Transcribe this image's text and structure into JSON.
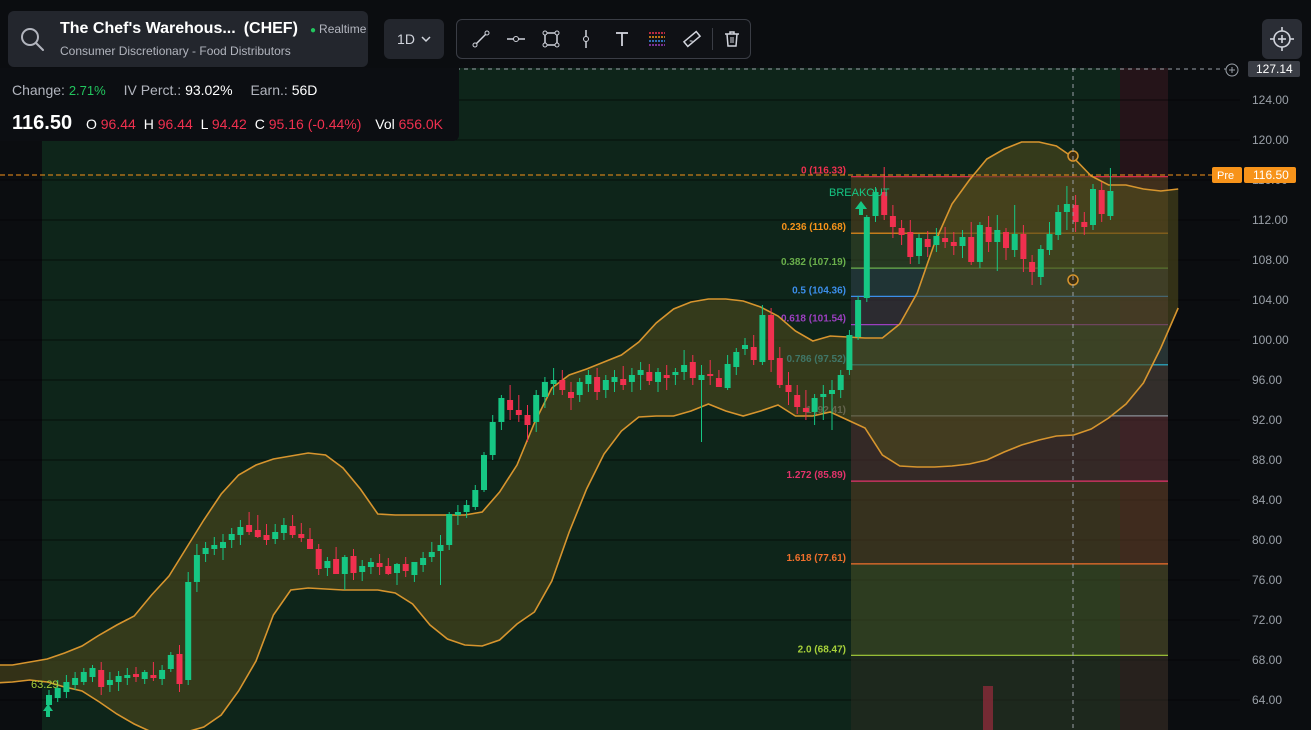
{
  "header": {
    "symbol_name": "The Chef's Warehous...",
    "ticker": "(CHEF)",
    "realtime": "Realtime",
    "sector": "Consumer Discretionary - Food Distributors",
    "timeframe": "1D"
  },
  "info": {
    "change_label": "Change:",
    "change_value": "2.71%",
    "iv_label": "IV Perct.:",
    "iv_value": "93.02%",
    "earn_label": "Earn.:",
    "earn_value": "56D",
    "last_price": "116.50",
    "open_label": "O",
    "open_value": "96.44",
    "high_label": "H",
    "high_value": "96.44",
    "low_label": "L",
    "low_value": "94.42",
    "close_label": "C",
    "close_value": "95.16 (-0.44%)",
    "vol_label": "Vol",
    "vol_value": "656.0K"
  },
  "toolbar": {
    "tools": [
      "trend-line-icon",
      "horizontal-line-icon",
      "rectangle-icon",
      "vertical-line-icon",
      "text-icon",
      "fibonacci-icon",
      "ruler-icon",
      "trash-icon"
    ]
  },
  "colors": {
    "bull": "#16c784",
    "bear": "#f0304f",
    "band": "#d7952e",
    "band_fill": "#4f4a1c",
    "background": "#0b0d10",
    "highlight": "#0f2a1c",
    "accent_orange": "#f7931a"
  },
  "chart_data": {
    "type": "candlestick",
    "y_axis": {
      "ticks": [
        "124.00",
        "120.00",
        "116.00",
        "112.00",
        "108.00",
        "104.00",
        "100.00",
        "96.00",
        "92.00",
        "88.00",
        "84.00",
        "80.00",
        "76.00",
        "72.00",
        "68.00",
        "64.00"
      ],
      "range": [
        61.0,
        127.5
      ],
      "cursor_label": "127.14"
    },
    "price_tag": {
      "label": "Pre",
      "value": "116.50",
      "price": 116.5
    },
    "fibonacci": [
      {
        "label": "0 (116.33)",
        "price": 116.33,
        "color": "#f0304f"
      },
      {
        "label": "0.236 (110.68)",
        "price": 110.68,
        "color": "#f7931a"
      },
      {
        "label": "0.382 (107.19)",
        "price": 107.19,
        "color": "#6ab04c"
      },
      {
        "label": "0.5 (104.36)",
        "price": 104.36,
        "color": "#3b8eea"
      },
      {
        "label": "0.618 (101.54)",
        "price": 101.54,
        "color": "#9b3fc0"
      },
      {
        "label": "0.786 (97.52)",
        "price": 97.52,
        "color": "#2ab8d6"
      },
      {
        "label": "1 (92.41)",
        "price": 92.41,
        "color": "#8a8f98"
      },
      {
        "label": "1.272 (85.89)",
        "price": 85.89,
        "color": "#e2336b"
      },
      {
        "label": "1.618 (77.61)",
        "price": 77.61,
        "color": "#f0702c"
      },
      {
        "label": "2.0 (68.47)",
        "price": 68.47,
        "color": "#a7d13a"
      }
    ],
    "annotations": [
      {
        "label": "63.29",
        "price": 63.29
      },
      {
        "label": "BREAKOUT",
        "price": 114.5
      }
    ],
    "candles": [
      [
        63.5,
        65,
        62.8,
        64.5
      ],
      [
        64.2,
        66,
        63.8,
        65.2
      ],
      [
        64.8,
        66.5,
        64.2,
        65.8
      ],
      [
        65.5,
        66.8,
        65,
        66.2
      ],
      [
        65.8,
        67.2,
        65.5,
        66.8
      ],
      [
        66.3,
        67.5,
        65.8,
        67.2
      ],
      [
        67,
        67.8,
        64.5,
        65.3
      ],
      [
        65.5,
        66.8,
        64.8,
        66
      ],
      [
        65.8,
        66.9,
        64.9,
        66.4
      ],
      [
        66.2,
        67.2,
        65.5,
        66.5
      ],
      [
        66.6,
        67.3,
        65.8,
        66.3
      ],
      [
        66.1,
        67,
        65.6,
        66.8
      ],
      [
        66.5,
        67.8,
        65.9,
        66.2
      ],
      [
        66.1,
        67.5,
        65.5,
        67
      ],
      [
        67.1,
        68.8,
        66.8,
        68.5
      ],
      [
        68.6,
        69.5,
        64.8,
        65.6
      ],
      [
        66,
        76.8,
        65.5,
        75.8
      ],
      [
        75.8,
        79.6,
        74.8,
        78.5
      ],
      [
        78.6,
        79.8,
        77.8,
        79.2
      ],
      [
        79.1,
        80.3,
        78.5,
        79.5
      ],
      [
        79.2,
        80.6,
        78,
        79.8
      ],
      [
        80,
        81.2,
        79.2,
        80.6
      ],
      [
        80.5,
        82,
        79.5,
        81.3
      ],
      [
        81.5,
        82.8,
        80.5,
        80.8
      ],
      [
        81,
        82.5,
        80.2,
        80.3
      ],
      [
        80.5,
        81.6,
        79.5,
        80
      ],
      [
        80.1,
        81.6,
        79.6,
        80.8
      ],
      [
        80.7,
        82.2,
        80,
        81.5
      ],
      [
        81.4,
        82.5,
        80.2,
        80.5
      ],
      [
        80.6,
        81.7,
        79.8,
        80.2
      ],
      [
        80.1,
        81.2,
        79.2,
        79.1
      ],
      [
        79.1,
        79.6,
        76.5,
        77.1
      ],
      [
        77.2,
        78.3,
        76.4,
        77.9
      ],
      [
        78.1,
        79.3,
        77,
        76.6
      ],
      [
        76.6,
        78.5,
        75,
        78.3
      ],
      [
        78.4,
        79.1,
        76,
        76.7
      ],
      [
        76.8,
        78,
        75.9,
        77.4
      ],
      [
        77.3,
        78.2,
        76.6,
        77.8
      ],
      [
        77.7,
        78.6,
        76.5,
        77.3
      ],
      [
        77.4,
        78.2,
        76.5,
        76.6
      ],
      [
        76.7,
        77.7,
        75.5,
        77.6
      ],
      [
        77.6,
        78.3,
        76.3,
        76.9
      ],
      [
        76.5,
        77.5,
        75.8,
        77.8
      ],
      [
        77.5,
        78.8,
        76.8,
        78.2
      ],
      [
        78.3,
        79.8,
        77.8,
        78.8
      ],
      [
        78.9,
        80.5,
        75.5,
        79.5
      ],
      [
        79.5,
        82.8,
        79,
        82.6
      ],
      [
        82.5,
        83.5,
        81.5,
        82.8
      ],
      [
        82.8,
        84,
        82.2,
        83.5
      ],
      [
        83.3,
        85.5,
        83,
        85
      ],
      [
        85,
        88.8,
        84.8,
        88.5
      ],
      [
        88.5,
        92.5,
        88,
        91.8
      ],
      [
        91.8,
        94.5,
        91,
        94.2
      ],
      [
        94,
        95.5,
        92,
        93
      ],
      [
        93,
        94.5,
        91.8,
        92.5
      ],
      [
        92.5,
        93.5,
        89.8,
        91.5
      ],
      [
        91.8,
        95,
        90.8,
        94.5
      ],
      [
        94.3,
        96.3,
        93.2,
        95.8
      ],
      [
        95.6,
        97.2,
        94.5,
        96
      ],
      [
        96,
        97,
        94.5,
        95
      ],
      [
        94.8,
        95.8,
        93,
        94.2
      ],
      [
        94.5,
        96.2,
        93.8,
        95.8
      ],
      [
        95.6,
        97,
        94.8,
        96.5
      ],
      [
        96.3,
        97.2,
        94,
        94.8
      ],
      [
        95,
        96.5,
        94.2,
        96
      ],
      [
        95.8,
        97,
        94.8,
        96.3
      ],
      [
        96.1,
        97.4,
        95,
        95.5
      ],
      [
        95.8,
        97.2,
        94.8,
        96.5
      ],
      [
        96.5,
        97.8,
        95,
        97
      ],
      [
        96.8,
        97.6,
        95.5,
        95.9
      ],
      [
        95.8,
        97.2,
        94.8,
        96.8
      ],
      [
        96.5,
        97.5,
        95,
        96.2
      ],
      [
        96.5,
        97.2,
        95.5,
        96.8
      ],
      [
        96.8,
        99,
        96,
        97.5
      ],
      [
        97.8,
        98.5,
        95.5,
        96.2
      ],
      [
        96,
        97.5,
        89.8,
        96.5
      ],
      [
        96.6,
        98,
        95.5,
        96.4
      ],
      [
        96.2,
        97,
        95.5,
        95.3
      ],
      [
        95.2,
        98.5,
        95,
        97.6
      ],
      [
        97.3,
        99.2,
        96.5,
        98.8
      ],
      [
        99.1,
        100.2,
        98.5,
        99.5
      ],
      [
        99.3,
        100.5,
        97.5,
        98
      ],
      [
        97.8,
        103.5,
        97.5,
        102.5
      ],
      [
        102.5,
        103.2,
        96.8,
        98
      ],
      [
        98.2,
        99.3,
        95.2,
        95.5
      ],
      [
        95.5,
        96.8,
        93.5,
        94.8
      ],
      [
        94.5,
        95.5,
        92.6,
        93.3
      ],
      [
        93.2,
        95,
        92,
        92.8
      ],
      [
        92.8,
        94.6,
        91.5,
        94.2
      ],
      [
        94.3,
        95.5,
        92,
        94.6
      ],
      [
        94.6,
        96,
        91,
        95
      ],
      [
        95,
        97,
        94.2,
        96.5
      ],
      [
        97,
        101,
        96.5,
        100.5
      ],
      [
        100.3,
        104.4,
        100,
        104
      ],
      [
        104.2,
        112.5,
        103.8,
        112.3
      ],
      [
        112.4,
        115.3,
        111.8,
        114.8
      ],
      [
        114.8,
        117.3,
        112,
        112.5
      ],
      [
        112.4,
        113.5,
        110.2,
        111.3
      ],
      [
        111.2,
        112,
        109.5,
        110.5
      ],
      [
        110.8,
        112,
        107.6,
        108.3
      ],
      [
        108.4,
        110.6,
        107.6,
        110.2
      ],
      [
        110.1,
        110.9,
        108.3,
        109.3
      ],
      [
        109.5,
        111.2,
        108.8,
        110.4
      ],
      [
        110.2,
        111.3,
        109.2,
        109.8
      ],
      [
        109.8,
        110.8,
        108.5,
        109.4
      ],
      [
        109.4,
        111,
        108.2,
        110.3
      ],
      [
        110.3,
        111.8,
        107.5,
        107.8
      ],
      [
        107.8,
        111.8,
        107.2,
        111.5
      ],
      [
        111.3,
        112.4,
        108.8,
        109.8
      ],
      [
        109.8,
        112.5,
        106.9,
        111
      ],
      [
        110.8,
        111.2,
        108,
        109.2
      ],
      [
        109,
        113.5,
        108.3,
        110.6
      ],
      [
        110.6,
        111.5,
        106.8,
        108.1
      ],
      [
        107.8,
        108.5,
        105.5,
        106.8
      ],
      [
        106.3,
        109.5,
        105.5,
        109.1
      ],
      [
        109,
        111.8,
        108.5,
        110.6
      ],
      [
        110.5,
        113.5,
        110,
        112.8
      ],
      [
        112.8,
        115.4,
        111,
        113.6
      ],
      [
        113.5,
        114.5,
        110.8,
        111.8
      ],
      [
        111.8,
        112.8,
        110.5,
        111.3
      ],
      [
        111.5,
        115.6,
        111,
        115.1
      ],
      [
        115,
        115.8,
        111.8,
        112.6
      ],
      [
        112.4,
        117.2,
        112,
        114.9
      ]
    ],
    "bollinger": {
      "upper": [
        67.5,
        67.5,
        67.8,
        68.1,
        68.7,
        69.4,
        70.5,
        71.5,
        72.4,
        74.5,
        76.4,
        79.2,
        82,
        84.6,
        86.5,
        87.5,
        88.1,
        88.4,
        88.7,
        88.5,
        87.2,
        85.1,
        82.6,
        82.5,
        82.5,
        82.5,
        82.5,
        82.5,
        82.8,
        84.8,
        87.5,
        91.7,
        95.2,
        96.5,
        97.1,
        97.8,
        98.5,
        99.8,
        101.7,
        103.1,
        103.8,
        104.1,
        104.1,
        103.9,
        103.3,
        102.4,
        100.9,
        99.9,
        100.4,
        100.3,
        100.2,
        100.2,
        101.6,
        104.7,
        109.7,
        113.6,
        116,
        118.1,
        119.1,
        119.8,
        119.8,
        119.4,
        118.2,
        116.4,
        115.5,
        115.5,
        115.1,
        114.9,
        115.1
      ],
      "lower": [
        65.7,
        65.8,
        66,
        65.8,
        65.3,
        64.9,
        63.8,
        62.6,
        61.6,
        60.8,
        60.6,
        60.8,
        61.3,
        62.5,
        64.9,
        67.9,
        72.5,
        75,
        75.2,
        75.1,
        75,
        75,
        75,
        74.7,
        73.6,
        71.5,
        70.1,
        69.5,
        69.4,
        70,
        71.6,
        72.8,
        75.9,
        80.8,
        85.1,
        88.6,
        90.9,
        92.3,
        92.4,
        92.4,
        92.9,
        93.6,
        92.9,
        92.4,
        92.9,
        93.5,
        92.4,
        92.4,
        92.8,
        92,
        91.2,
        88.5,
        87.4,
        87.3,
        87.3,
        87.4,
        87.6,
        88,
        88.8,
        89.5,
        90,
        90.4,
        90.5,
        91.1,
        92.2,
        93.6,
        95.7,
        99.2,
        103.2
      ]
    }
  }
}
